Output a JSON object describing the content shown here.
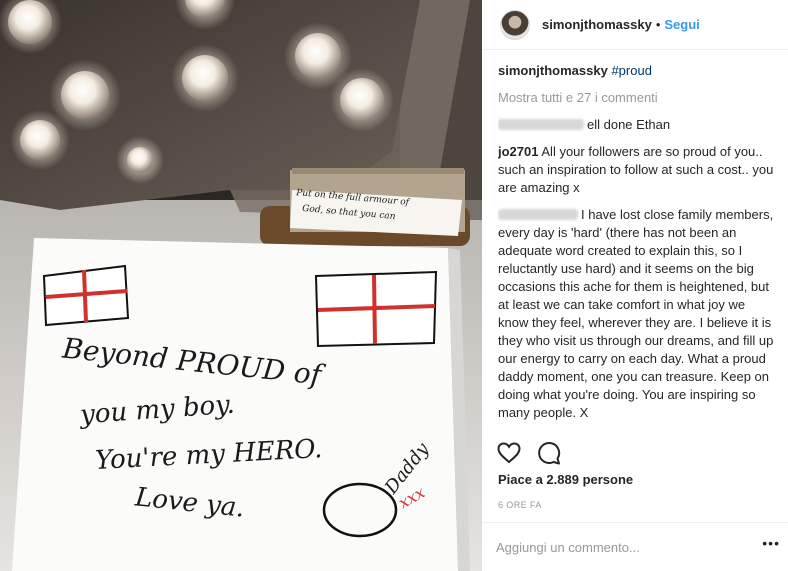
{
  "post": {
    "username": "simonjthomassky",
    "follow_label": "Segui",
    "separator": "•",
    "caption_username": "simonjthomassky",
    "caption_text": "#proud",
    "view_all_comments": "Mostra tutti e 27 i commenti",
    "likes_text": "Piace a 2.889 persone",
    "time_ago": "6 ORE FA",
    "add_comment_placeholder": "Aggiungi un commento...",
    "more_label": "•••"
  },
  "comments": [
    {
      "username": "",
      "text": "ell done Ethan",
      "username_blurred": true
    },
    {
      "username": "jo2701",
      "text": "All your followers are so proud of you.. such an inspiration to follow at such a cost.. you are amazing x",
      "username_blurred": false
    },
    {
      "username": "",
      "text": "I have lost close family members, every day is 'hard' (there has not been an adequate word created to explain this, so I reluctantly use hard) and it seems on the big occasions this ache for them is heightened, but at least we can take comfort in what joy we know they feel, wherever they are. I believe it is they who visit us through our dreams, and fill up our energy to carry on each day. What a proud daddy moment, one you can treasure. Keep on doing what you're doing. You are inspiring so many people. X",
      "username_blurred": true
    }
  ],
  "photo": {
    "note_lines": [
      "Beyond PROUD of",
      "you my boy.",
      "You're my HERO.",
      "Love ya."
    ],
    "signature": "Daddy",
    "kisses": "xxx",
    "card_text_lines": [
      "Put on the full armour of",
      "God, so that you can"
    ]
  },
  "icons": {
    "like": "heart-icon",
    "comment": "speech-bubble-icon"
  },
  "colors": {
    "link": "#3897f0",
    "hashtag": "#003569",
    "muted": "#999999",
    "flag_cross": "#d0312d"
  }
}
